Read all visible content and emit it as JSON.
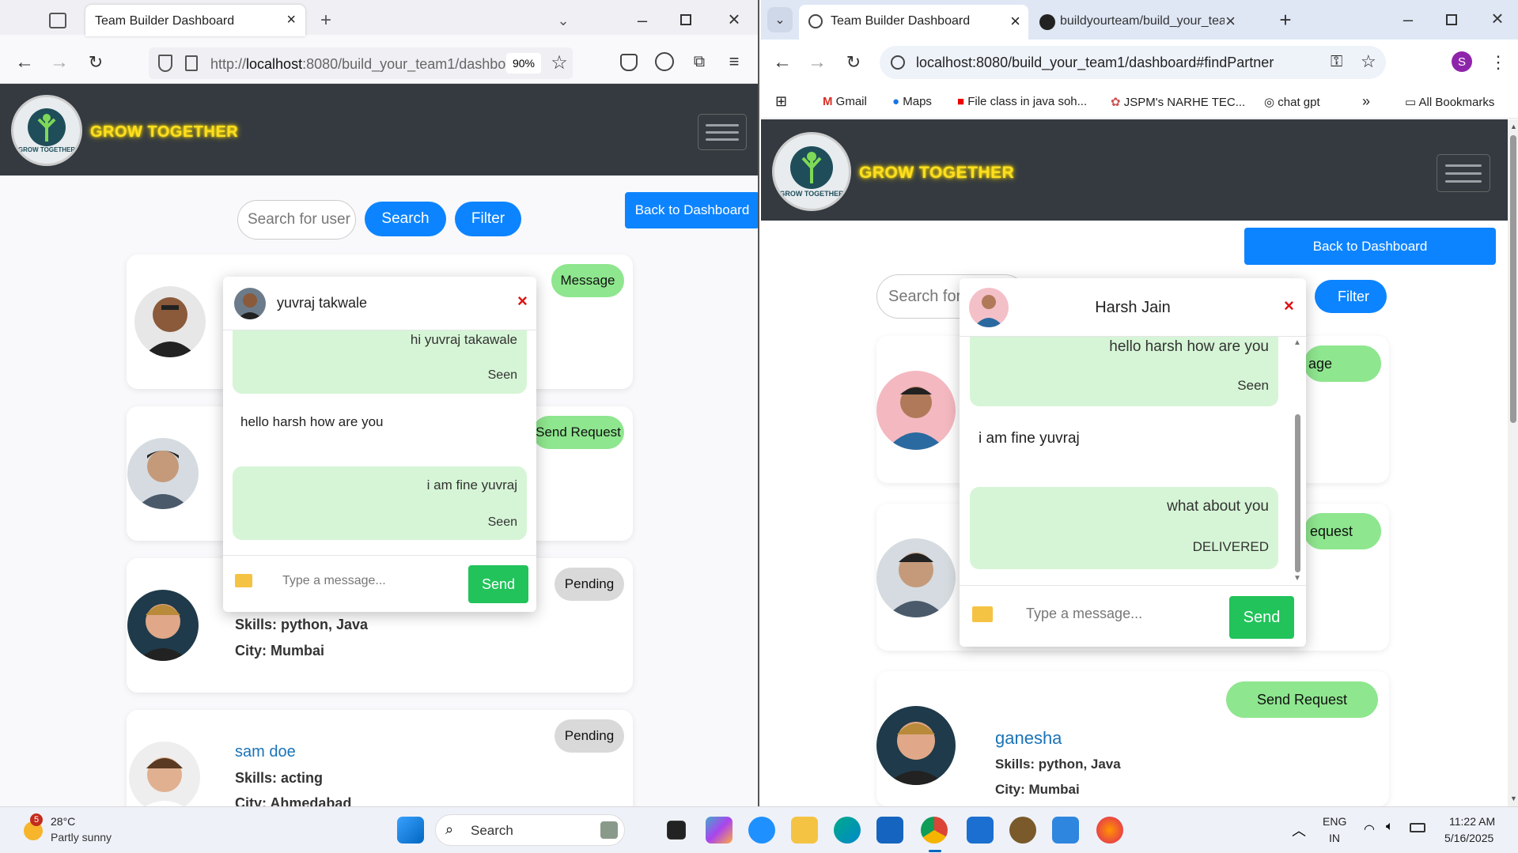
{
  "left": {
    "tab_title": "Team Builder Dashboard",
    "url_prefix": "http://",
    "url_host": "localhost",
    "url_rest": ":8080/build_your_team1/dashbo",
    "zoom": "90%",
    "brand": "GROW TOGETHER",
    "logo_text": "GROW TOGETHER",
    "search_placeholder": "Search for user",
    "search_btn": "Search",
    "filter_btn": "Filter",
    "back_btn": "Back to Dashboard",
    "cards": [
      {
        "action": "Message"
      },
      {
        "action": "Send Request"
      },
      {
        "action": "Pending",
        "skills": "Skills: python, Java",
        "city": "City: Mumbai"
      },
      {
        "action": "Pending",
        "name": "sam doe",
        "skills": "Skills: acting",
        "city": "City: Ahmedabad"
      }
    ],
    "chat": {
      "user": "yuvraj takwale",
      "close": "×",
      "msg1": "hi yuvraj takawale",
      "msg1_status": "Seen",
      "msg2": "hello harsh how are you",
      "msg3": "i am fine yuvraj",
      "msg3_status": "Seen",
      "input_placeholder": "Type a message...",
      "send": "Send"
    }
  },
  "right": {
    "tabs": [
      {
        "title": "Team Builder Dashboard"
      },
      {
        "title": "buildyourteam/build_your_team"
      }
    ],
    "url": "localhost:8080/build_your_team1/dashboard#findPartner",
    "profile_initial": "S",
    "bookmarks": [
      "Gmail",
      "Maps",
      "File class in java soh...",
      "JSPM's NARHE TEC...",
      "chat gpt"
    ],
    "all_bookmarks": "All Bookmarks",
    "brand": "GROW TOGETHER",
    "logo_text": "GROW TOGETHER",
    "back_btn": "Back to Dashboard",
    "search_placeholder": "Search for",
    "filter_btn": "Filter",
    "cards": [
      {
        "action": "age"
      },
      {
        "action": "equest"
      },
      {
        "action": "Send Request",
        "name": "ganesha",
        "skills": "Skills: python, Java",
        "city": "City: Mumbai"
      }
    ],
    "chat": {
      "user": "Harsh Jain",
      "close": "×",
      "msg1": "hello harsh how are you",
      "msg1_status": "Seen",
      "msg2": "i am fine yuvraj",
      "msg3": "what about you",
      "msg3_status": "DELIVERED",
      "input_placeholder": "Type a message...",
      "send": "Send"
    }
  },
  "taskbar": {
    "weather_temp": "28°C",
    "weather_desc": "Partly sunny",
    "weather_badge": "5",
    "search": "Search",
    "lang1": "ENG",
    "lang2": "IN",
    "time": "11:22 AM",
    "date": "5/16/2025"
  },
  "colors": {
    "primary": "#0d84ff",
    "nav_dark": "#343a40",
    "brand_yellow": "#ffde21",
    "bubble": "#d6f5d6",
    "send_green": "#21c35a",
    "pending": "#d9d9d9",
    "message_green": "#8ee68e"
  }
}
